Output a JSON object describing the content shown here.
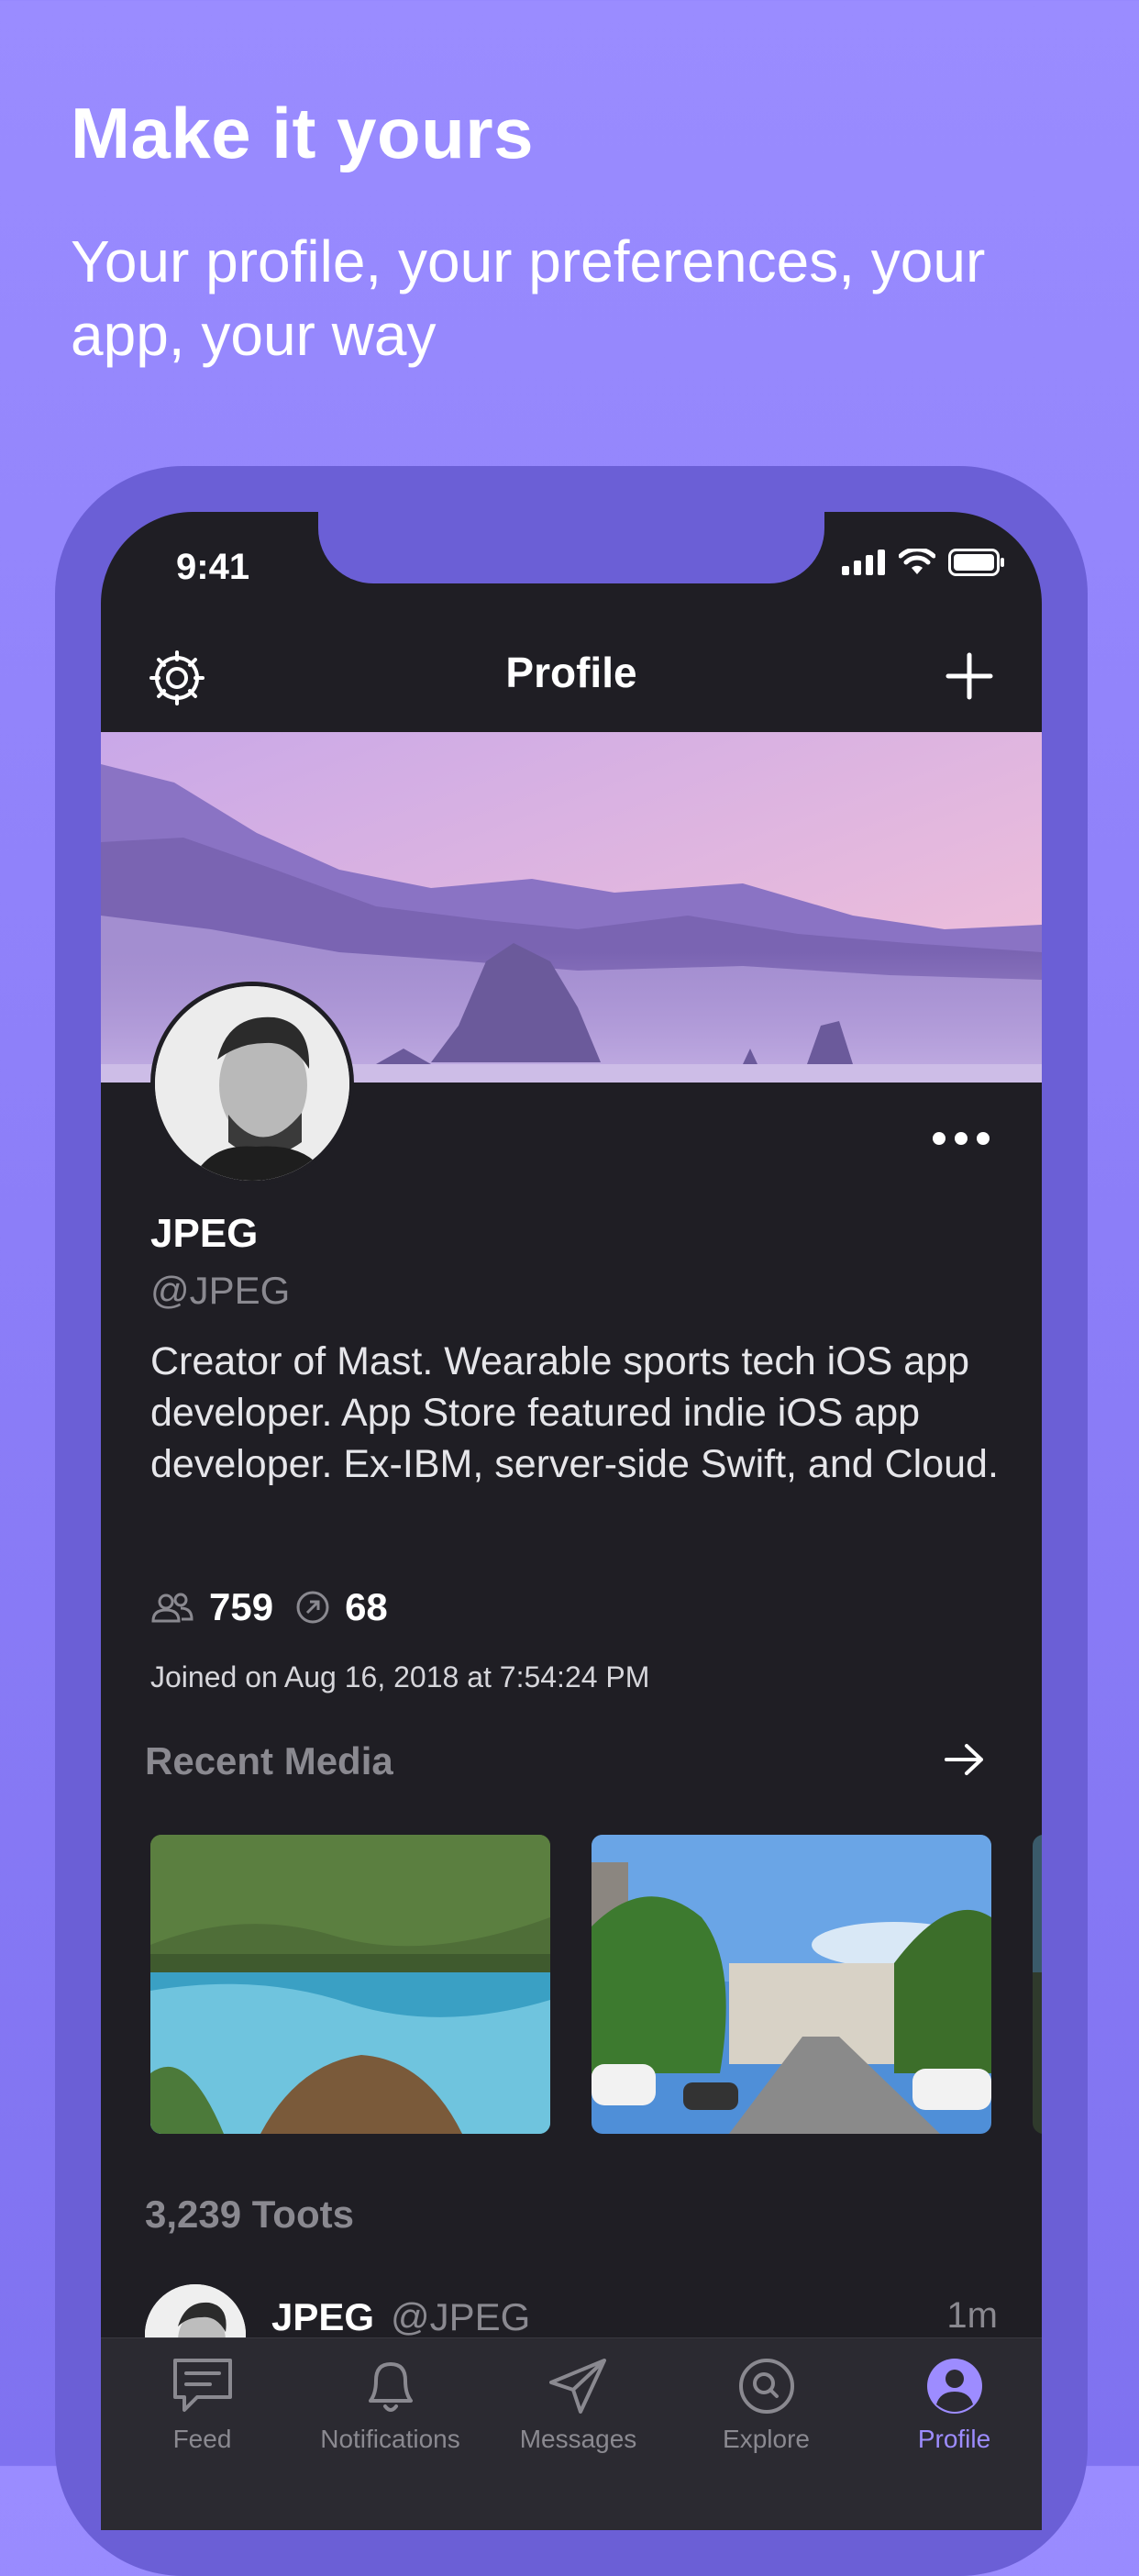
{
  "promo": {
    "headline": "Make it yours",
    "subline": "Your profile, your preferences, your app, your way"
  },
  "status_bar": {
    "time": "9:41"
  },
  "nav": {
    "title": "Profile",
    "left_icon": "gear-icon",
    "right_icon": "plus-icon"
  },
  "profile": {
    "display_name": "JPEG",
    "handle": "@JPEG",
    "bio": "Creator of Mast. Wearable sports tech iOS app developer. App Store featured indie iOS app developer. Ex-IBM, server-side Swift, and Cloud.",
    "followers": "759",
    "following": "68",
    "joined": "Joined on Aug 16, 2018 at 7:54:24 PM"
  },
  "recent_media": {
    "title": "Recent Media"
  },
  "toots": {
    "count_label": "3,239 Toots",
    "first_post": {
      "name": "JPEG",
      "handle": "@JPEG",
      "time": "1m"
    }
  },
  "tabs": [
    {
      "label": "Feed",
      "icon": "feed-icon"
    },
    {
      "label": "Notifications",
      "icon": "bell-icon"
    },
    {
      "label": "Messages",
      "icon": "paper-plane-icon"
    },
    {
      "label": "Explore",
      "icon": "search-icon"
    },
    {
      "label": "Profile",
      "icon": "profile-icon",
      "active": true
    }
  ],
  "colors": {
    "background": "#9a8cff",
    "device_frame": "#6b5fd6",
    "screen": "#1f1e24",
    "tab_bar": "#2b2a31",
    "accent": "#9d8cff",
    "muted_text": "#8a8990"
  }
}
